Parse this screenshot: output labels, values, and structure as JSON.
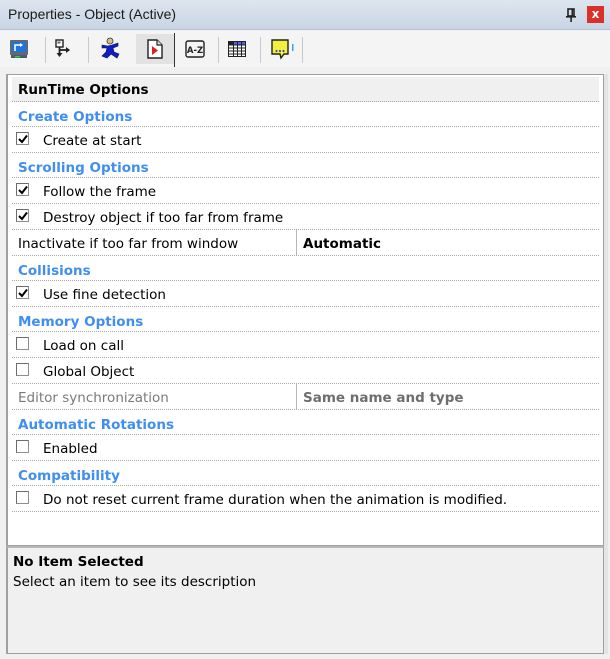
{
  "window": {
    "title": "Properties - Object (Active)",
    "pin_icon": "pin-icon",
    "close_icon": "close-icon",
    "close_label": "x"
  },
  "toolbar": {
    "buttons": [
      {
        "name": "display-options",
        "icon": "monitor-icon"
      },
      {
        "name": "size-position",
        "icon": "move-arrows-icon"
      },
      {
        "name": "movement",
        "icon": "running-man-icon"
      },
      {
        "name": "runtime-options",
        "icon": "document-play-icon",
        "active": true
      },
      {
        "name": "sort-alphabetically",
        "icon": "az-sort-icon"
      },
      {
        "name": "values",
        "icon": "table-grid-icon"
      },
      {
        "name": "about",
        "icon": "speech-bubble-icon"
      }
    ]
  },
  "grid": {
    "header": "RunTime Options",
    "rows": [
      {
        "type": "category",
        "label": "Create Options"
      },
      {
        "type": "check",
        "label": "Create at start",
        "checked": true
      },
      {
        "type": "category",
        "label": "Scrolling Options"
      },
      {
        "type": "check",
        "label": "Follow the frame",
        "checked": true
      },
      {
        "type": "check",
        "label": "Destroy object if too far from frame",
        "checked": true
      },
      {
        "type": "prop",
        "label": "Inactivate if too far from window",
        "value": "Automatic"
      },
      {
        "type": "category",
        "label": "Collisions"
      },
      {
        "type": "check",
        "label": "Use fine detection",
        "checked": true
      },
      {
        "type": "category",
        "label": "Memory Options"
      },
      {
        "type": "check",
        "label": "Load on call",
        "checked": false
      },
      {
        "type": "check",
        "label": "Global Object",
        "checked": false
      },
      {
        "type": "prop",
        "label": "Editor synchronization",
        "value": "Same name and type",
        "disabled": true
      },
      {
        "type": "category",
        "label": "Automatic Rotations"
      },
      {
        "type": "check",
        "label": "Enabled",
        "checked": false
      },
      {
        "type": "category",
        "label": "Compatibility"
      },
      {
        "type": "check",
        "label": "Do not reset current frame duration when the animation is modified.",
        "checked": false
      }
    ]
  },
  "description": {
    "title": "No Item Selected",
    "text": "Select an item to see its description"
  },
  "colors": {
    "category": "#3f8ef0",
    "close_button": "#d9302a"
  }
}
